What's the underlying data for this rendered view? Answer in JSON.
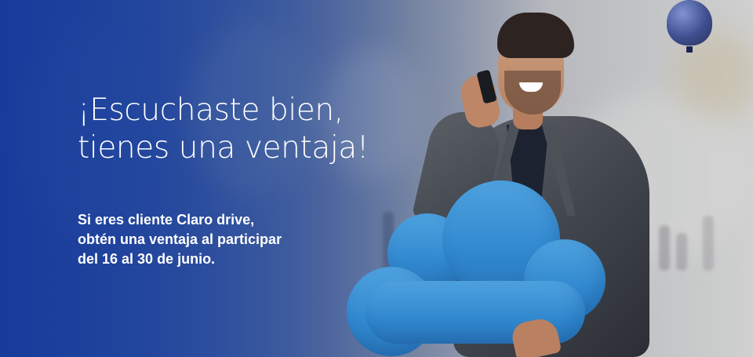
{
  "banner": {
    "headline": {
      "line1": "¡Escuchaste bien,",
      "line2": "tienes una ventaja!"
    },
    "subtext": {
      "line1": "Si eres cliente Claro drive,",
      "line2": "obtén una ventaja al participar",
      "line3": "del 16 al 30 de junio."
    },
    "colors": {
      "primary_blue": "#1a3f9c",
      "cloud_blue": "#2f86cd",
      "text_white": "#ffffff"
    }
  }
}
